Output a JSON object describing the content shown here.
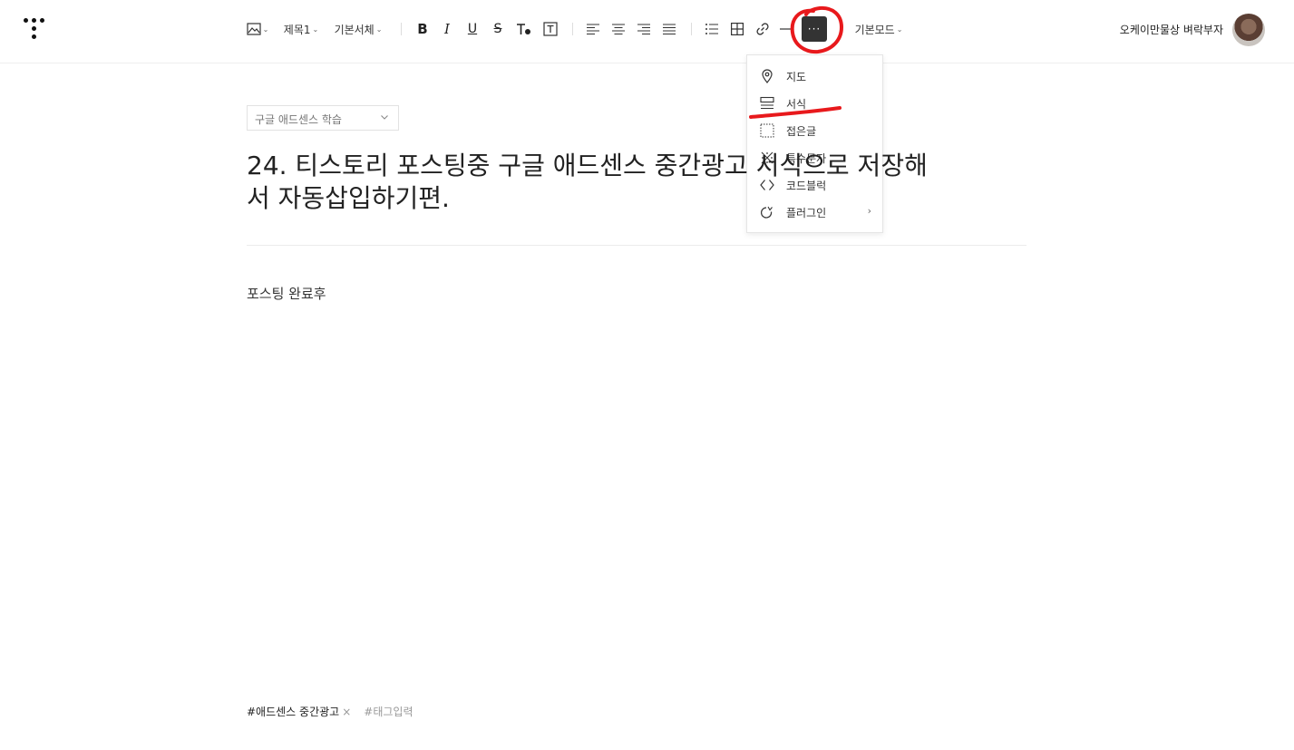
{
  "toolbar": {
    "heading_style": "제목1",
    "font_family": "기본서체",
    "more_label": "···",
    "mode": "기본모드",
    "user_name": "오케이만물상 벼락부자"
  },
  "more_menu": {
    "items": [
      {
        "label": "지도",
        "icon": "map-pin-icon"
      },
      {
        "label": "서식",
        "icon": "template-icon"
      },
      {
        "label": "접은글",
        "icon": "fold-icon"
      },
      {
        "label": "특수문자",
        "icon": "special-char-icon"
      },
      {
        "label": "코드블럭",
        "icon": "code-icon"
      },
      {
        "label": "플러그인",
        "icon": "plugin-icon"
      }
    ],
    "submenu_arrow": "›"
  },
  "editor": {
    "category": "구글 애드센스 학습",
    "title_line1": "24. 티스토리 포스팅중 구글 애드센스  중간광고 서식으로 저장해",
    "title_line2": "서 자동삽입하기편.",
    "body": "포스팅 완료후"
  },
  "tags": {
    "items": [
      "#애드센스 중간광고"
    ],
    "remove_symbol": "×",
    "placeholder": "#태그입력"
  },
  "annotation_color": "#e8191c"
}
